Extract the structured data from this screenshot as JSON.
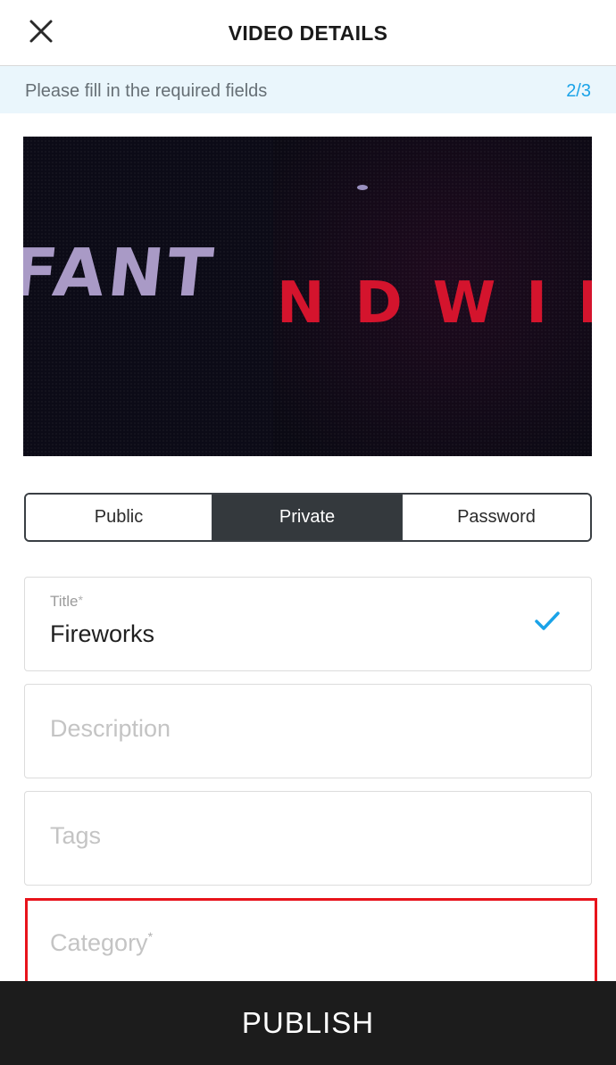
{
  "header": {
    "title": "VIDEO DETAILS",
    "close_icon": "close-icon"
  },
  "notice": {
    "text": "Please fill in the required fields",
    "step": "2/3"
  },
  "preview": {
    "left_text": "FANT",
    "right_text": "NDWIN"
  },
  "privacy": {
    "options": [
      "Public",
      "Private",
      "Password"
    ],
    "selected": "Private"
  },
  "fields": {
    "title": {
      "label": "Title",
      "required_mark": "*",
      "value": "Fireworks",
      "status_icon": "checkmark-icon"
    },
    "description": {
      "placeholder": "Description"
    },
    "tags": {
      "placeholder": "Tags"
    },
    "category": {
      "placeholder": "Category",
      "required_mark": "*"
    }
  },
  "footer": {
    "publish_label": "PUBLISH"
  },
  "colors": {
    "accent": "#1aa3e8",
    "notice_bg": "#eaf6fc",
    "selected_segment": "#34393d",
    "error_border": "#e8131b",
    "footer_bg": "#1c1c1c"
  }
}
